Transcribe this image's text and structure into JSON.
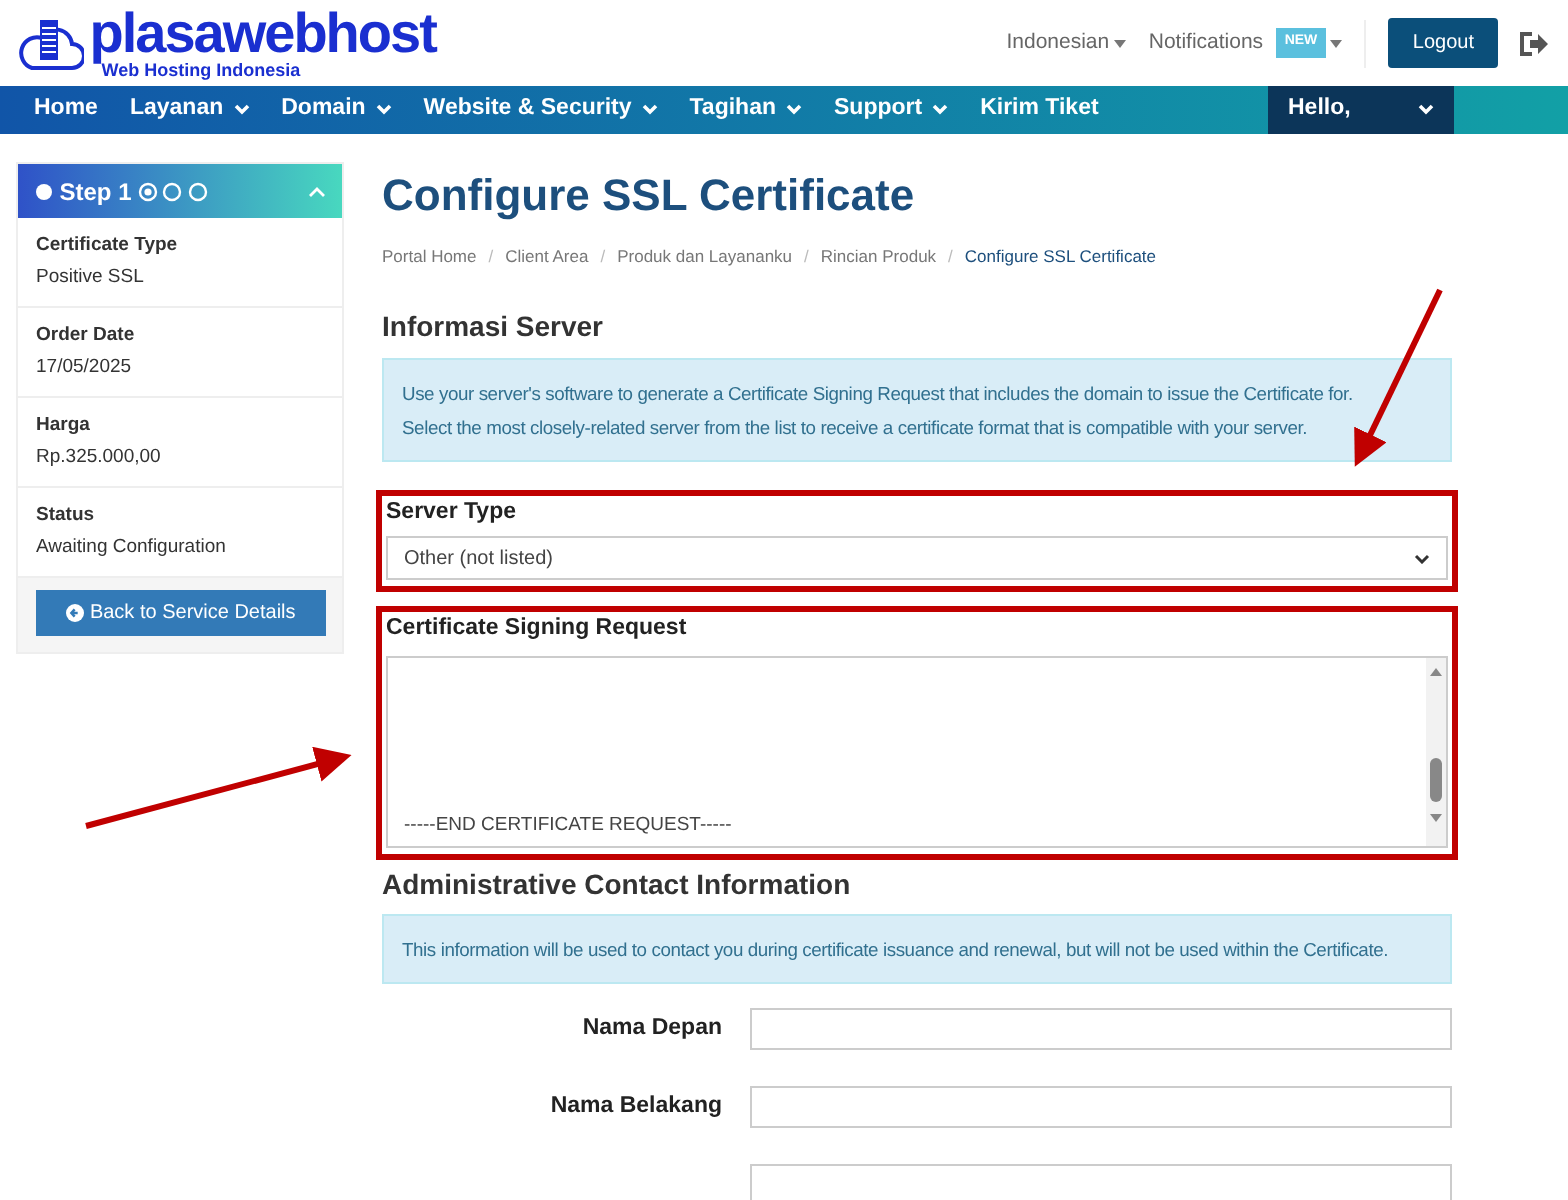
{
  "header": {
    "logo_name": "plasawebhost",
    "logo_tagline": "Web Hosting Indonesia",
    "language": "Indonesian",
    "notifications": {
      "label": "Notifications",
      "badge": "NEW"
    },
    "logout": "Logout"
  },
  "nav": {
    "items": [
      {
        "label": "Home",
        "dropdown": false
      },
      {
        "label": "Layanan",
        "dropdown": true
      },
      {
        "label": "Domain",
        "dropdown": true
      },
      {
        "label": "Website & Security",
        "dropdown": true
      },
      {
        "label": "Tagihan",
        "dropdown": true
      },
      {
        "label": "Support",
        "dropdown": true
      },
      {
        "label": "Kirim Tiket",
        "dropdown": false
      }
    ],
    "user": {
      "label": "Hello,",
      "dropdown": true
    }
  },
  "sidebar": {
    "title": "Step 1",
    "steps": [
      {
        "selected": true
      },
      {
        "selected": false
      },
      {
        "selected": false
      }
    ],
    "expanded": true,
    "items": [
      {
        "label": "Certificate Type",
        "value": "Positive SSL"
      },
      {
        "label": "Order Date",
        "value": "17/05/2025"
      },
      {
        "label": "Harga",
        "value": "Rp.325.000,00"
      },
      {
        "label": "Status",
        "value": "Awaiting Configuration"
      }
    ],
    "button": "Back to Service Details"
  },
  "page": {
    "title": "Configure SSL Certificate",
    "breadcrumb_separator": "/",
    "breadcrumb": [
      {
        "label": "Portal Home",
        "selected": false
      },
      {
        "label": "Client Area",
        "selected": false
      },
      {
        "label": "Produk dan Layananku",
        "selected": false
      },
      {
        "label": "Rincian Produk",
        "selected": false
      },
      {
        "label": "Configure SSL Certificate",
        "selected": true
      }
    ]
  },
  "server_section": {
    "title": "Informasi Server",
    "info": [
      "Use your server's software to generate a Certificate Signing Request that includes the domain to issue the Certificate for.",
      "Select the most closely-related server from the list to receive a certificate format that is compatible with your server."
    ],
    "server_type": {
      "label": "Server Type",
      "value": "Other (not listed)",
      "highlighted": true
    },
    "csr": {
      "label": "Certificate Signing Request",
      "value": "-----END CERTIFICATE REQUEST-----",
      "highlighted": true
    }
  },
  "contact_section": {
    "title": "Administrative Contact Information",
    "info": "This information will be used to contact you during certificate issuance and renewal, but will not be used within the Certificate.",
    "fields": [
      {
        "kind": "labeled",
        "label": "Nama Depan"
      },
      {
        "kind": "labeled",
        "label": "Nama Belakang"
      },
      {
        "kind": "cut"
      }
    ]
  }
}
